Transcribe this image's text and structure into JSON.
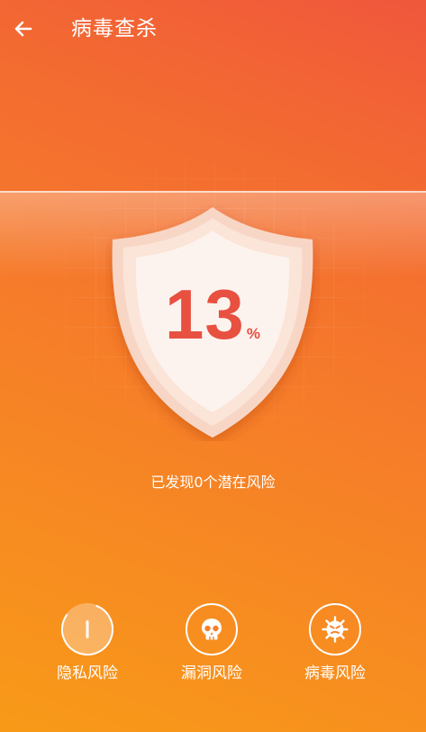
{
  "header": {
    "title": "病毒查杀"
  },
  "scan": {
    "percent": "13",
    "percent_unit": "%",
    "status": "已发现0个潜在风险"
  },
  "risks": [
    {
      "label": "隐私风险",
      "icon": "privacy-bar-icon"
    },
    {
      "label": "漏洞风险",
      "icon": "skull-icon"
    },
    {
      "label": "病毒风险",
      "icon": "virus-icon"
    }
  ],
  "colors": {
    "gradient_top": "#f0573c",
    "gradient_bottom": "#f89a18",
    "percent_text": "#e85040",
    "shield_outer": "#f8d6c6",
    "shield_inner": "#fdf3ee"
  }
}
